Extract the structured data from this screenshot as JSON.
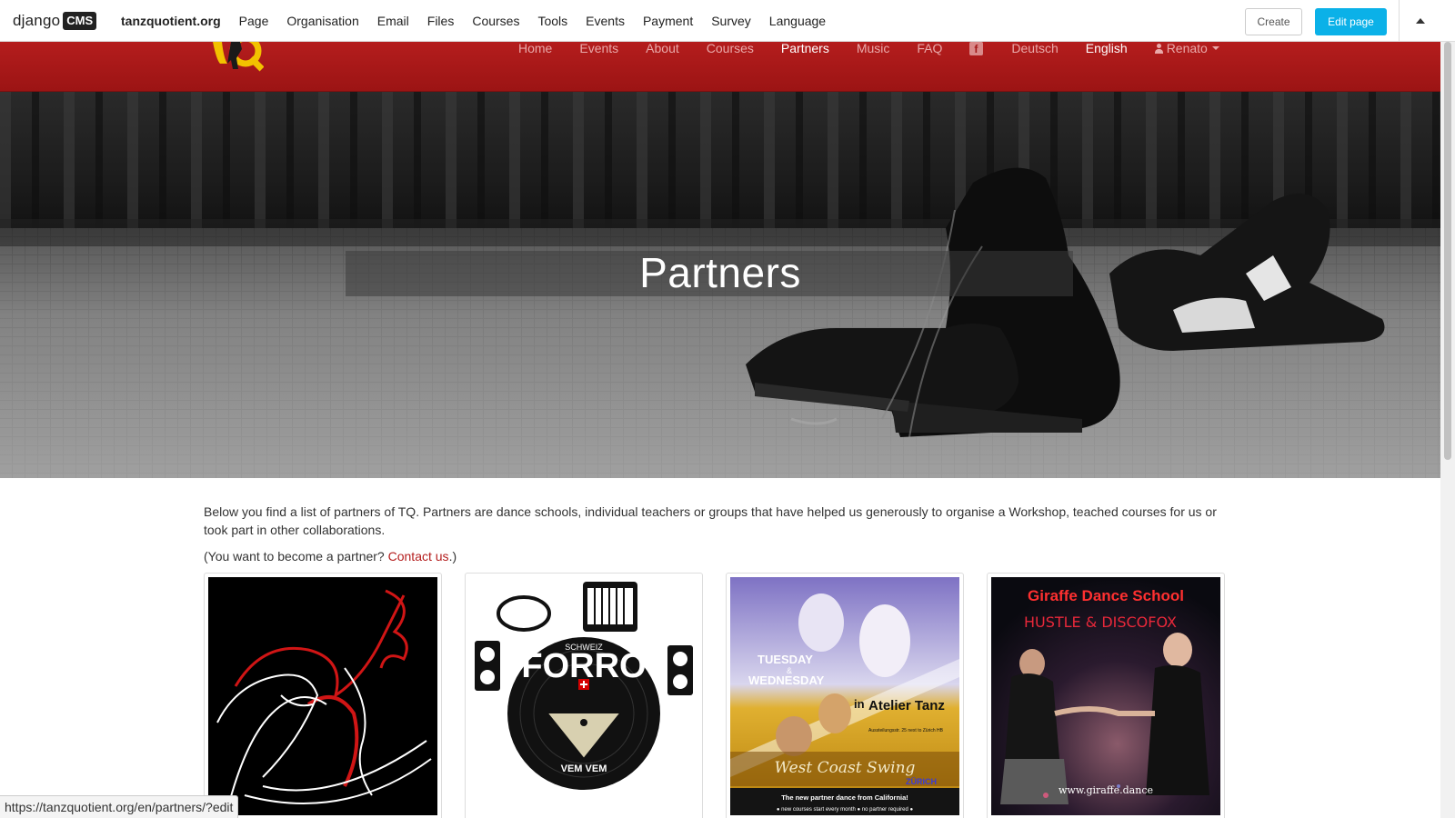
{
  "cms_toolbar": {
    "logo_text": "django",
    "logo_badge": "CMS",
    "site": "tanzquotient.org",
    "menu": [
      "Page",
      "Organisation",
      "Email",
      "Files",
      "Courses",
      "Tools",
      "Events",
      "Payment",
      "Survey",
      "Language"
    ],
    "create_label": "Create",
    "edit_label": "Edit page",
    "collapse_icon": "triangle-up-icon"
  },
  "site_nav": {
    "logo_icon": "tq-logo",
    "items": [
      "Home",
      "Events",
      "About",
      "Courses",
      "Partners",
      "Music",
      "FAQ"
    ],
    "active": "Partners",
    "facebook_icon": "facebook-icon",
    "languages": [
      "Deutsch",
      "English"
    ],
    "active_language": "English",
    "user": "Renato"
  },
  "hero": {
    "title": "Partners",
    "image": "dance-shoes-on-stage-photo"
  },
  "content": {
    "intro": "Below you find a list of partners of TQ. Partners are dance schools, individual teachers or groups that have helped us generously to organise a Workshop, teached courses for us or took part in other collaborations.",
    "become_prefix": "(You want to become a partner? ",
    "contact_link": "Contact us",
    "become_suffix": ".)"
  },
  "partners": [
    {
      "image": "dancing-couple-red-white-line-art"
    },
    {
      "image": "forro-schweiz-vinyl-logo",
      "badge_text": "FORRÓ",
      "sub_text": "SCHWEIZ",
      "bottom_text": "VEM VEM"
    },
    {
      "image": "west-coast-swing-zurich-poster",
      "line1": "TUESDAY",
      "line2": "&",
      "line3": "WEDNESDAY",
      "in_text": "in",
      "venue": "Atelier Tanz",
      "address": "Aussteilungsstr. 25 next to Zürich HB",
      "title": "West Coast Swing",
      "city": "ZÜRICH",
      "tagline": "The new partner dance from California!",
      "note": "● new courses start every month ● no partner required ●"
    },
    {
      "image": "giraffe-dance-school-photo",
      "name": "Giraffe Dance School",
      "subtitle": "HUSTLE & DISCOFOX",
      "url": "www.giraffe.dance"
    }
  ],
  "status_bar": {
    "url": "https://tanzquotient.org/en/partners/?edit"
  },
  "colors": {
    "nav_red": "#b41d1d",
    "cms_blue": "#0bb1e8",
    "link_red": "#b41d1d"
  }
}
